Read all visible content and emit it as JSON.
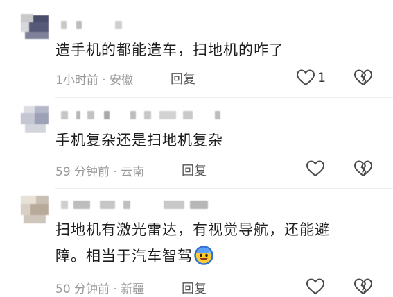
{
  "comments": [
    {
      "text": "造手机的都能造车，扫地机的咋了",
      "time": "1小时前",
      "location": "安徽",
      "reply_label": "回复",
      "like_count": "1"
    },
    {
      "text": "手机复杂还是扫地机复杂",
      "time": "59 分钟前",
      "location": "云南",
      "reply_label": "回复",
      "like_count": ""
    },
    {
      "text_line1": "扫地机有激光雷达，有视觉导航，还能避",
      "text_line2": "障。相当于汽车智驾",
      "time": "50 分钟前",
      "location": "新疆",
      "reply_label": "回复",
      "like_count": "",
      "emoji": "grinning-sweat-emoji"
    }
  ],
  "meta_separator": " · ",
  "icons": {
    "like": "heart-outline-icon",
    "dislike": "broken-heart-icon"
  },
  "colors": {
    "text": "#1e1e1e",
    "meta": "#9a9a9a",
    "icon": "#4a4a4a"
  }
}
